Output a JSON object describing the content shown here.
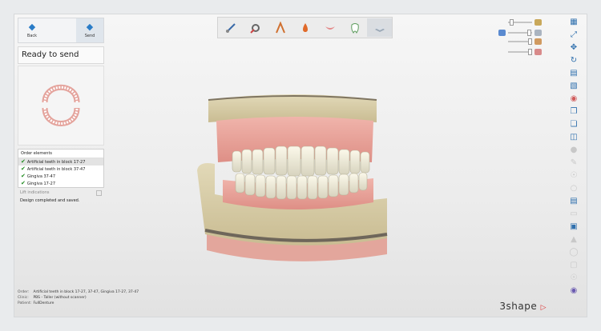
{
  "nav": {
    "back_label": "Back",
    "send_label": "Send"
  },
  "panel": {
    "title": "Ready to send",
    "order_header": "Order elements",
    "order_items": [
      "Artificial teeth in block 17-27",
      "Artificial teeth in block 37-47",
      "Gingiva 37-47",
      "Gingiva 17-27"
    ],
    "lift_label": "Lift indications",
    "status": "Design completed and saved."
  },
  "toolbar": {
    "tools": [
      "pen-icon",
      "tool-settings-icon",
      "rake-icon",
      "drop-icon",
      "gingiva-icon",
      "tooth-icon",
      "model-icon"
    ]
  },
  "footer": {
    "order_key": "Order:",
    "order_value": "Artificial teeth in block 17-27, 37-47, Gingiva 17-27, 37-47",
    "clinic_key": "Clinic:",
    "clinic_value": "PBS - Taller (without scanner)",
    "patient_key": "Patient:",
    "patient_value": "FullDenture"
  },
  "brand": {
    "logo_text": "3shape"
  },
  "colors": {
    "accent": "#2a7cc7",
    "check": "#1e8a1e",
    "gingiva": "#e8a8a0",
    "teeth": "#f2f0e2",
    "stone": "#d6cba7"
  }
}
